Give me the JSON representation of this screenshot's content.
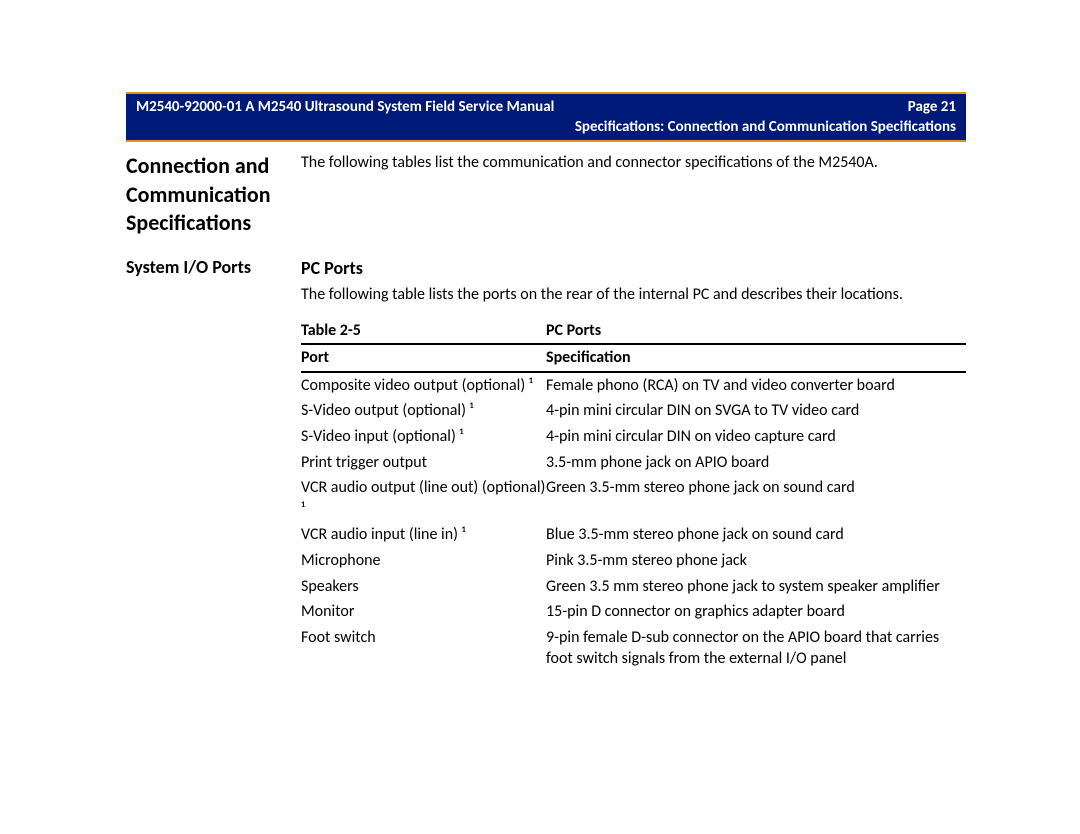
{
  "header": {
    "doc_id": "M2540-92000-01 A M2540 Ultrasound System Field Service Manual",
    "page_label": "Page 21",
    "section_path": "Specifications: Connection and Communication Specifications"
  },
  "side": {
    "main_heading": "Connection and Commu­nication Specifications",
    "sub_heading": "System I/O Ports"
  },
  "body": {
    "intro": "The following tables list the communication and connector specifications of the M2540A.",
    "pc_ports_heading": "PC Ports",
    "pc_ports_intro": "The following table lists the ports on the rear of the internal PC and describes their locations.",
    "table_label": "Table 2-5",
    "table_title": "PC Ports",
    "columns": {
      "port": "Port",
      "spec": "Specification"
    },
    "rows": [
      {
        "port": "Composite video output (optional) ¹",
        "spec": "Female phono (RCA) on TV and video converter board"
      },
      {
        "port": "S-Video output (optional) ¹",
        "spec": "4-pin mini circular DIN on SVGA to TV video card"
      },
      {
        "port": "S-Video input (optional) ¹",
        "spec": "4-pin mini circular DIN on video capture card"
      },
      {
        "port": "Print trigger output",
        "spec": "3.5-mm phone jack on APIO board"
      },
      {
        "port": "VCR audio output (line out) (optional) ¹",
        "spec": "Green 3.5-mm stereo phone jack on sound card"
      },
      {
        "port": "VCR audio input (line in) ¹",
        "spec": "Blue 3.5-mm stereo phone jack on sound card"
      },
      {
        "port": "Microphone",
        "spec": "Pink 3.5-mm stereo phone jack"
      },
      {
        "port": "Speakers",
        "spec": "Green 3.5 mm stereo phone jack to system speaker amplifier"
      },
      {
        "port": "Monitor",
        "spec": "15-pin D connector on graphics adapter board"
      },
      {
        "port": "Foot switch",
        "spec": "9-pin female D-sub connector on the APIO board that carries foot switch signals from the external I/O panel"
      }
    ]
  }
}
